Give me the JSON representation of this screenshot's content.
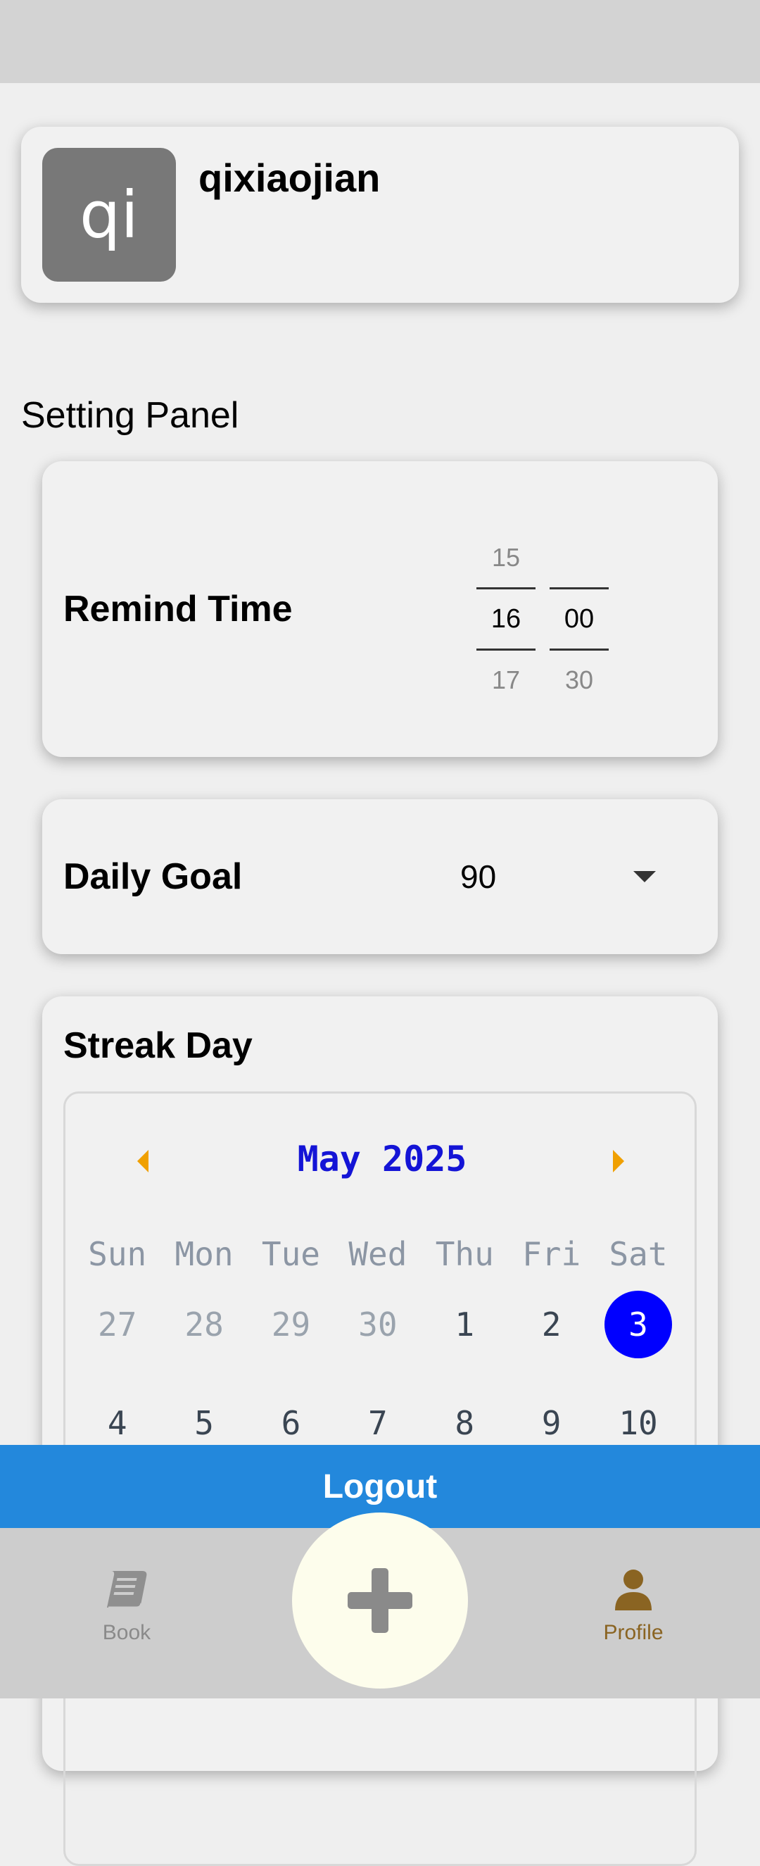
{
  "profile": {
    "avatar_initials": "qi",
    "username": "qixiaojian"
  },
  "settings": {
    "title": "Setting Panel",
    "remind_time": {
      "label": "Remind Time",
      "hours": [
        "15",
        "16",
        "17"
      ],
      "minutes": [
        "",
        "00",
        "30"
      ]
    },
    "daily_goal": {
      "label": "Daily Goal",
      "value": "90"
    },
    "streak": {
      "label": "Streak Day",
      "month_label": "May 2025",
      "weekdays": [
        "Sun",
        "Mon",
        "Tue",
        "Wed",
        "Thu",
        "Fri",
        "Sat"
      ],
      "weeks": [
        [
          "27",
          "28",
          "29",
          "30",
          "1",
          "2",
          "3"
        ],
        [
          "4",
          "5",
          "6",
          "7",
          "8",
          "9",
          "10"
        ]
      ],
      "highlighted_day": "3"
    }
  },
  "logout_label": "Logout",
  "nav": {
    "book_label": "Book",
    "profile_label": "Profile",
    "add_icon": "plus-icon"
  },
  "colors": {
    "accent_blue": "#2388dc",
    "calendar_month": "#1414d6",
    "calendar_arrow": "#f0a000",
    "selected_day": "#0000ff",
    "profile_active": "#8a6422"
  }
}
